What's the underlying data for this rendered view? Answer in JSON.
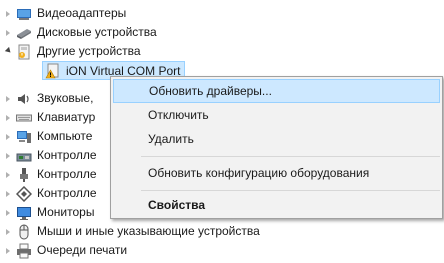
{
  "tree": {
    "items": [
      {
        "label": "Видеоадаптеры",
        "icon": "display-adapter-icon",
        "expanded": false
      },
      {
        "label": "Дисковые устройства",
        "icon": "disk-drive-icon",
        "expanded": false
      },
      {
        "label": "Другие устройства",
        "icon": "other-devices-icon",
        "expanded": true
      },
      {
        "label": "iON Virtual COM Port",
        "icon": "unknown-device-warning-icon",
        "child": true
      },
      {
        "label": "Звуковые,",
        "icon": "sound-icon",
        "expanded": false
      },
      {
        "label": "Клавиатур",
        "icon": "keyboard-icon",
        "expanded": false
      },
      {
        "label": "Компьюте",
        "icon": "computer-icon",
        "expanded": false
      },
      {
        "label": "Контролле",
        "icon": "storage-controller-icon",
        "expanded": false
      },
      {
        "label": "Контролле",
        "icon": "usb-controller-icon",
        "expanded": false
      },
      {
        "label": "Контролле",
        "icon": "network-controller-icon",
        "expanded": false
      },
      {
        "label": "Мониторы",
        "icon": "monitor-icon",
        "expanded": false
      },
      {
        "label": "Мыши и иные указывающие устройства",
        "icon": "mouse-icon",
        "expanded": false
      },
      {
        "label": "Очереди печати",
        "icon": "printer-icon",
        "expanded": false
      }
    ]
  },
  "context_menu": {
    "items": [
      {
        "label": "Обновить драйверы...",
        "highlighted": true
      },
      {
        "label": "Отключить"
      },
      {
        "label": "Удалить"
      },
      {
        "label": "Обновить конфигурацию оборудования"
      },
      {
        "label": "Свойства",
        "bold": true
      }
    ]
  }
}
